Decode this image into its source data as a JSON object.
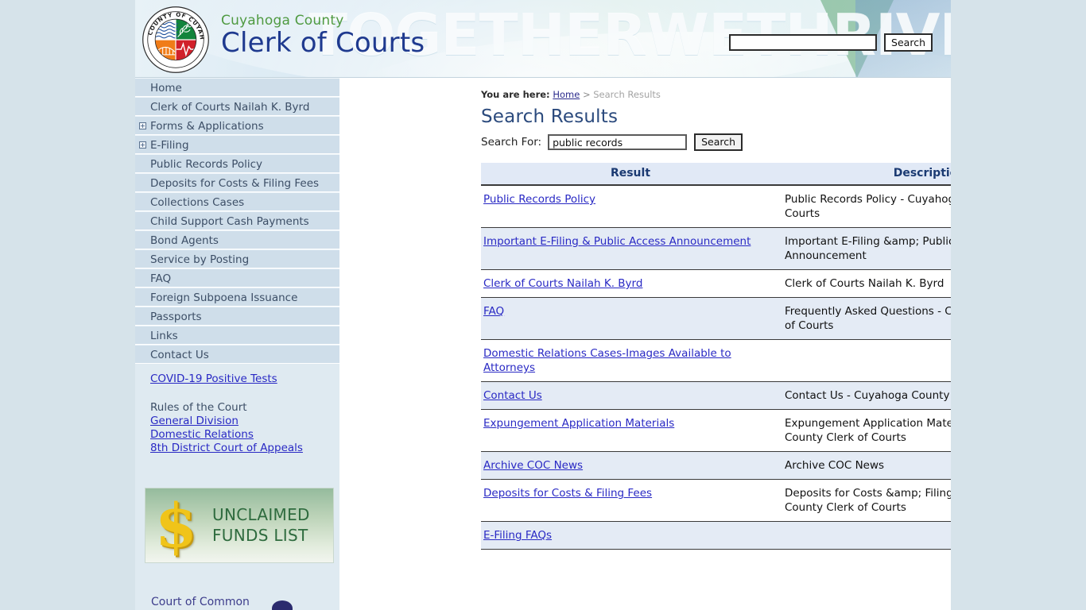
{
  "header": {
    "watermark": "TOGETHERWETHRIVE",
    "seal": {
      "top_text": "COUNTY OF CUYAHOGA",
      "bottom_text": "OHIO"
    },
    "brand_line1": "Cuyahoga County",
    "brand_line2": "Clerk of Courts",
    "search": {
      "value": "",
      "placeholder": "",
      "button_label": "Search"
    },
    "colors": {
      "brand_green": "#4f9a41",
      "brand_navy": "#1f3a8f"
    }
  },
  "sidebar": {
    "items": [
      {
        "label": "Home",
        "toggle": ""
      },
      {
        "label": "Clerk of Courts Nailah K. Byrd",
        "toggle": ""
      },
      {
        "label": "Forms & Applications",
        "toggle": "+"
      },
      {
        "label": "E-Filing",
        "toggle": "+"
      },
      {
        "label": "Public Records Policy",
        "toggle": ""
      },
      {
        "label": "Deposits for Costs & Filing Fees",
        "toggle": ""
      },
      {
        "label": "Collections Cases",
        "toggle": ""
      },
      {
        "label": "Child Support Cash Payments",
        "toggle": ""
      },
      {
        "label": "Bond Agents",
        "toggle": ""
      },
      {
        "label": "Service by Posting",
        "toggle": ""
      },
      {
        "label": "FAQ",
        "toggle": ""
      },
      {
        "label": "Foreign Subpoena Issuance",
        "toggle": ""
      },
      {
        "label": "Passports",
        "toggle": ""
      },
      {
        "label": "Links",
        "toggle": ""
      },
      {
        "label": "Contact Us",
        "toggle": ""
      }
    ],
    "covid_link": "COVID-19 Positive Tests",
    "rules_heading": "Rules of the Court",
    "rules_links": [
      "General Division",
      "Domestic Relations",
      "8th District Court of Appeals"
    ],
    "unclaimed_banner": {
      "symbol": "$",
      "line1": "UNCLAIMED",
      "line2": "FUNDS LIST"
    },
    "bottom_badge": "Court of Common"
  },
  "main": {
    "breadcrumb": {
      "label": "You are here:",
      "home": "Home",
      "separator": ">",
      "current": "Search Results"
    },
    "title": "Search Results",
    "search_for": {
      "label": "Search For:",
      "value": "public records",
      "placeholder": "",
      "button_label": "Search"
    },
    "table": {
      "columns": [
        "Result",
        "Description"
      ],
      "rows": [
        {
          "result": "Public Records Policy",
          "description": "Public Records Policy - Cuyahoga County Clerk of Courts",
          "shade": "plain"
        },
        {
          "result": "Important E-Filing & Public Access Announcement",
          "description": "Important E-Filing &amp; Public Access Announcement",
          "shade": "alt"
        },
        {
          "result": "Clerk of Courts Nailah K. Byrd",
          "description": "Clerk of Courts Nailah K. Byrd",
          "shade": "plain"
        },
        {
          "result": "FAQ",
          "description": "Frequently Asked Questions - Cuyahoga County Clerk of Courts",
          "shade": "alt"
        },
        {
          "result": "Domestic Relations Cases-Images Available to Attorneys",
          "description": "",
          "shade": "plain"
        },
        {
          "result": "Contact Us",
          "description": "Contact Us - Cuyahoga County Clerk of Courts",
          "shade": "alt"
        },
        {
          "result": "Expungement Application Materials",
          "description": "Expungement Application Materials - Cuyahoga County Clerk of Courts",
          "shade": "plain"
        },
        {
          "result": "Archive COC News",
          "description": "Archive COC News",
          "shade": "alt"
        },
        {
          "result": "Deposits for Costs & Filing Fees",
          "description": "Deposits for Costs &amp; Filing Fees - Cuyahoga County Clerk of Courts",
          "shade": "plain"
        },
        {
          "result": "E-Filing FAQs",
          "description": "",
          "shade": "alt"
        }
      ]
    }
  }
}
